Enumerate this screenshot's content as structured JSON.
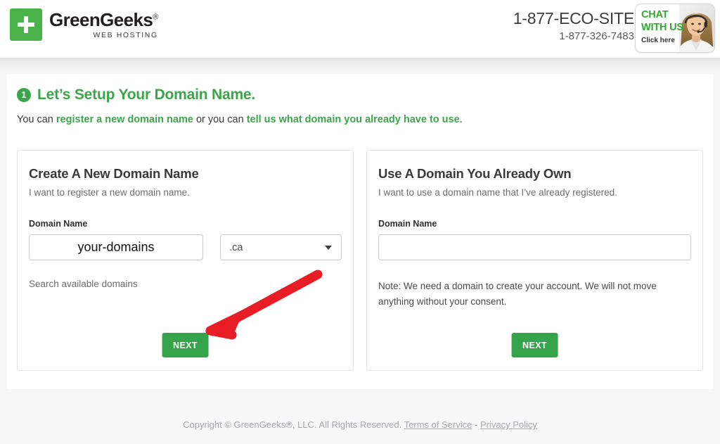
{
  "header": {
    "logo": {
      "name": "GreenGeeks",
      "registered_mark": "®",
      "tagline": "WEB HOSTING",
      "icon": "plus-icon",
      "color": "#49b349"
    },
    "phone_vanity": "1-877-ECO-SITE",
    "phone_numeric": "1-877-326-7483",
    "chat": {
      "line1": "CHAT",
      "line2": "WITH US",
      "cta": "Click here",
      "color": "#2faa2f"
    }
  },
  "main": {
    "step_number": "1",
    "step_title": "Let’s Setup Your Domain Name.",
    "intro": {
      "part1": "You can ",
      "link1": "register a new domain name",
      "part2": " or you can ",
      "link2": "tell us what domain you already have to use",
      "part3": "."
    },
    "accent_green": "#3aa549",
    "cards": [
      {
        "title": "Create A New Domain Name",
        "subtitle": "I want to register a new domain name.",
        "field_label": "Domain Name",
        "input_value": "your-domains",
        "input_placeholder": "",
        "tld_selected": ".ca",
        "helper": "Search available domains",
        "next_label": "NEXT"
      },
      {
        "title": "Use A Domain You Already Own",
        "subtitle": "I want to use a domain name that I’ve already registered.",
        "field_label": "Domain Name",
        "input_value": "",
        "input_placeholder": "",
        "note": "Note: We need a domain to create your account. We will not move anything without your consent.",
        "next_label": "NEXT"
      }
    ],
    "annotation": {
      "type": "arrow",
      "color": "#e81c24",
      "points_to": "next-button-left-card"
    }
  },
  "footer": {
    "copyright": "Copyright © GreenGeeks®, LLC. All Rights Reserved.",
    "terms_link": "Terms of Service",
    "separator": "-",
    "privacy_link": "Privacy Policy"
  }
}
